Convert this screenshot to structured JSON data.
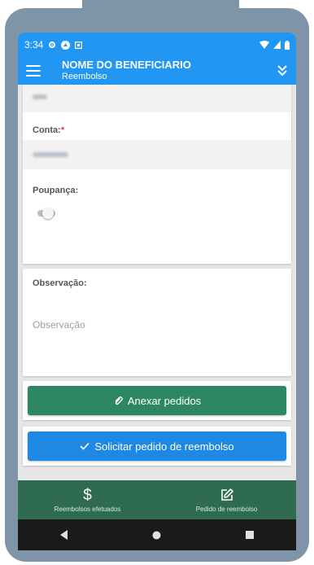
{
  "status_bar": {
    "time": "3:34"
  },
  "app_bar": {
    "title": "NOME DO BENEFICIARIO",
    "subtitle": "Reembolso"
  },
  "form": {
    "conta_label": "Conta:",
    "required_mark": "*",
    "poupanca_label": "Poupança:",
    "poupanca_enabled": false,
    "observacao_label": "Observação:",
    "observacao_placeholder": "Observação"
  },
  "buttons": {
    "attach": "Anexar pedidos",
    "submit": "Solicitar pedido de reembolso"
  },
  "bottom_nav": {
    "items": [
      {
        "label": "Reembolsos efetuados",
        "icon": "dollar-icon"
      },
      {
        "label": "Pedido de reembolso",
        "icon": "edit-icon"
      }
    ]
  },
  "colors": {
    "primary": "#2196f3",
    "attach_button": "#2e8764",
    "submit_button": "#1e88e5",
    "bottom_nav": "#2e6b51",
    "required": "#e53935"
  }
}
